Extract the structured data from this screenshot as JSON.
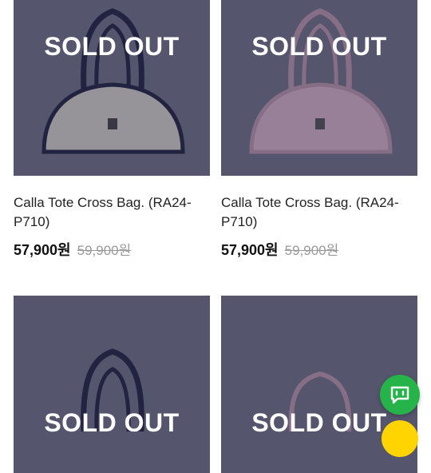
{
  "products": [
    {
      "status": "SOLD OUT",
      "name": "Calla Tote Cross Bag. (RA24-P710)",
      "price": "57,900원",
      "original_price": "59,900원",
      "bag_color": "#e6e2d6",
      "trim_color": "#1c1f3d"
    },
    {
      "status": "SOLD OUT",
      "name": "Calla Tote Cross Bag. (RA24-P710)",
      "price": "57,900원",
      "original_price": "59,900원",
      "bag_color": "#e9c2d4",
      "trim_color": "#c9a0b6"
    },
    {
      "status": "SOLD OUT",
      "name": "",
      "price": "",
      "original_price": "",
      "bag_color": "#e6e2d6",
      "trim_color": "#1c1f3d"
    },
    {
      "status": "SOLD OUT",
      "name": "",
      "price": "",
      "original_price": "",
      "bag_color": "#e9c2d4",
      "trim_color": "#c9a0b6"
    }
  ],
  "floating": {
    "chat_icon": "chat-bubble-icon",
    "chat_color": "#25b34a",
    "secondary_color": "#ffd400"
  }
}
